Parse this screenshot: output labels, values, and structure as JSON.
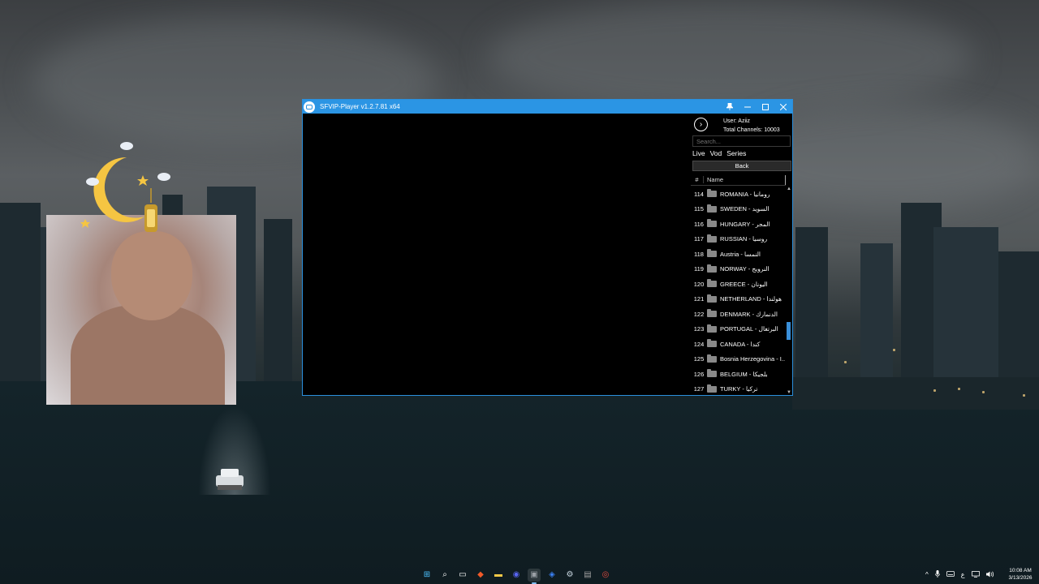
{
  "window": {
    "title": "SFVIP-Player v1.2.7.81 x64",
    "controls": {
      "pin": "📌",
      "minimize": "—",
      "maximize": "☐",
      "close": "✕"
    }
  },
  "sidebar": {
    "next_icon": "›",
    "user_label": "User: Aziiz",
    "total_channels_label": "Total Channels: 10003",
    "search_placeholder": "Search...",
    "tabs": [
      "Live",
      "Vod",
      "Series"
    ],
    "back_label": "Back",
    "header": {
      "num": "#",
      "name": "Name"
    },
    "channels": [
      {
        "num": "114",
        "name": "ROMANIA - رومانيا"
      },
      {
        "num": "115",
        "name": "SWEDEN - السويد"
      },
      {
        "num": "116",
        "name": "HUNGARY - المجر"
      },
      {
        "num": "117",
        "name": "RUSSIAN - روسيا"
      },
      {
        "num": "118",
        "name": "Austria - النمسا"
      },
      {
        "num": "119",
        "name": "NORWAY - النرويج"
      },
      {
        "num": "120",
        "name": "GREECE - اليونان"
      },
      {
        "num": "121",
        "name": "NETHERLAND - هولندا"
      },
      {
        "num": "122",
        "name": "DENMARK - الدنمارك"
      },
      {
        "num": "123",
        "name": "PORTUGAL - البرتغال"
      },
      {
        "num": "124",
        "name": "CANADA - كندا"
      },
      {
        "num": "125",
        "name": "Bosnia Herzegovina - I..."
      },
      {
        "num": "126",
        "name": "BELGIUM - بلجيكا"
      },
      {
        "num": "127",
        "name": "TURKY - تركيا"
      }
    ],
    "scroll_position": 0.72
  },
  "taskbar": {
    "apps": [
      {
        "icon": "windows-start-icon",
        "glyph": "⊞",
        "color": "#4cc2ff"
      },
      {
        "icon": "search-icon",
        "glyph": "⌕",
        "color": "#ffffff"
      },
      {
        "icon": "task-view-icon",
        "glyph": "▭",
        "color": "#ffffff"
      },
      {
        "icon": "brave-browser-icon",
        "glyph": "◆",
        "color": "#f15a29"
      },
      {
        "icon": "file-explorer-icon",
        "glyph": "▬",
        "color": "#f7c948"
      },
      {
        "icon": "discord-icon",
        "glyph": "◉",
        "color": "#5865f2"
      },
      {
        "icon": "sfvip-player-icon",
        "glyph": "▣",
        "color": "#9aa0a6"
      },
      {
        "icon": "sync-app-icon",
        "glyph": "◈",
        "color": "#3b82f6"
      },
      {
        "icon": "steam-icon",
        "glyph": "⚙",
        "color": "#c7d5e0"
      },
      {
        "icon": "xbox-app-icon",
        "glyph": "▤",
        "color": "#a0a0a0"
      },
      {
        "icon": "chrome-icon",
        "glyph": "◎",
        "color": "#e04a3f"
      }
    ],
    "tray": {
      "chevron": "^",
      "mic": "🎤",
      "keyboard": "⌨",
      "input_lang": "ع",
      "network": "▭",
      "volume": "🔈"
    },
    "time": "10:08 AM",
    "date": "3/13/2026"
  }
}
